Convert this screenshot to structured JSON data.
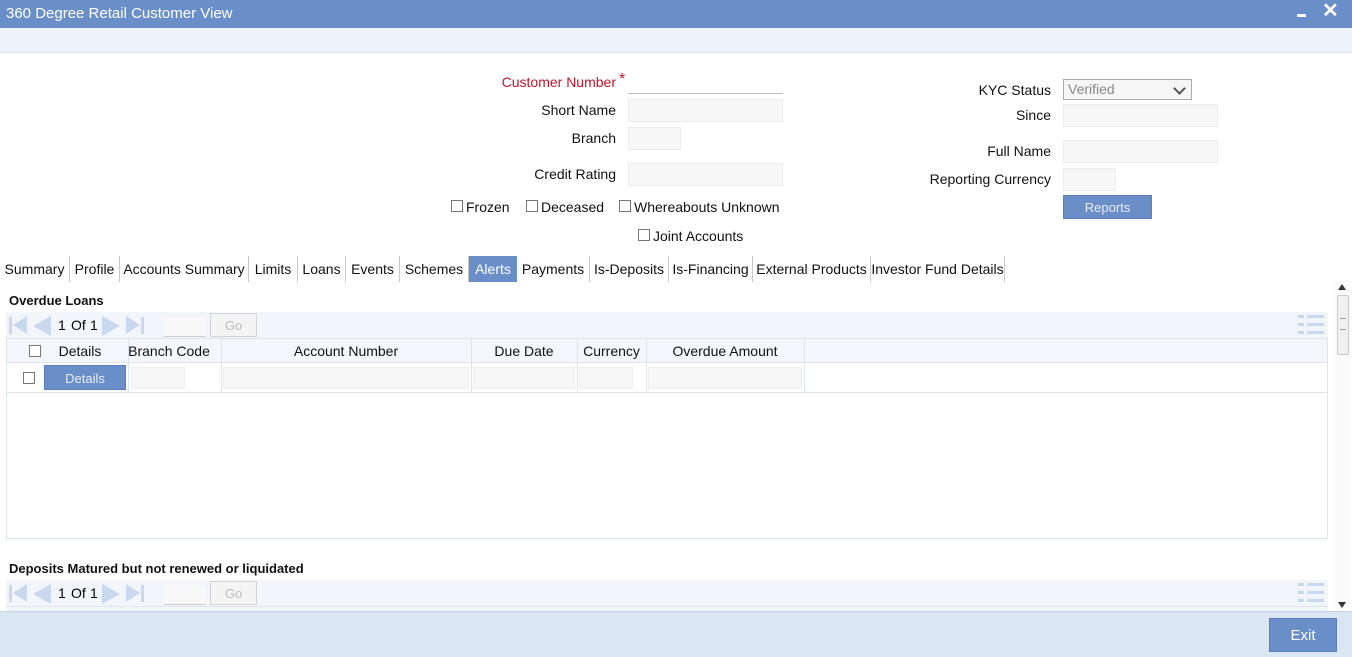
{
  "window": {
    "title": "360 Degree Retail Customer View",
    "close_glyph": "✕"
  },
  "form": {
    "customer_number_label": "Customer Number",
    "required_mark": "*",
    "short_name_label": "Short Name",
    "branch_label": "Branch",
    "credit_rating_label": "Credit Rating",
    "kyc_status_label": "KYC Status",
    "kyc_status_value": "Verified",
    "since_label": "Since",
    "full_name_label": "Full Name",
    "reporting_currency_label": "Reporting Currency",
    "reports_button": "Reports",
    "frozen_label": "Frozen",
    "deceased_label": "Deceased",
    "whereabouts_label": "Whereabouts Unknown",
    "joint_accounts_label": "Joint Accounts"
  },
  "tabs": [
    {
      "label": "Summary",
      "active": false
    },
    {
      "label": "Profile",
      "active": false
    },
    {
      "label": "Accounts Summary",
      "active": false
    },
    {
      "label": "Limits",
      "active": false
    },
    {
      "label": "Loans",
      "active": false
    },
    {
      "label": "Events",
      "active": false
    },
    {
      "label": "Schemes",
      "active": false
    },
    {
      "label": "Alerts",
      "active": true
    },
    {
      "label": "Payments",
      "active": false
    },
    {
      "label": "Is-Deposits",
      "active": false
    },
    {
      "label": "Is-Financing",
      "active": false
    },
    {
      "label": "External Products",
      "active": false
    },
    {
      "label": "Investor Fund Details",
      "active": false
    }
  ],
  "overdue_loans": {
    "title": "Overdue Loans",
    "pager": {
      "current": "1",
      "of_label": "Of",
      "total": "1",
      "go_label": "Go"
    },
    "columns": [
      "Details",
      "Branch Code",
      "Account Number",
      "Due Date",
      "Currency",
      "Overdue Amount"
    ],
    "row_details_button": "Details"
  },
  "deposits_matured": {
    "title": "Deposits Matured but not renewed or liquidated",
    "pager": {
      "current": "1",
      "of_label": "Of",
      "total": "1",
      "go_label": "Go"
    }
  },
  "footer": {
    "exit_label": "Exit"
  },
  "colors": {
    "accent": "#6a8ec8",
    "required": "#c0142c",
    "footer_bg": "#dbe6f3"
  }
}
